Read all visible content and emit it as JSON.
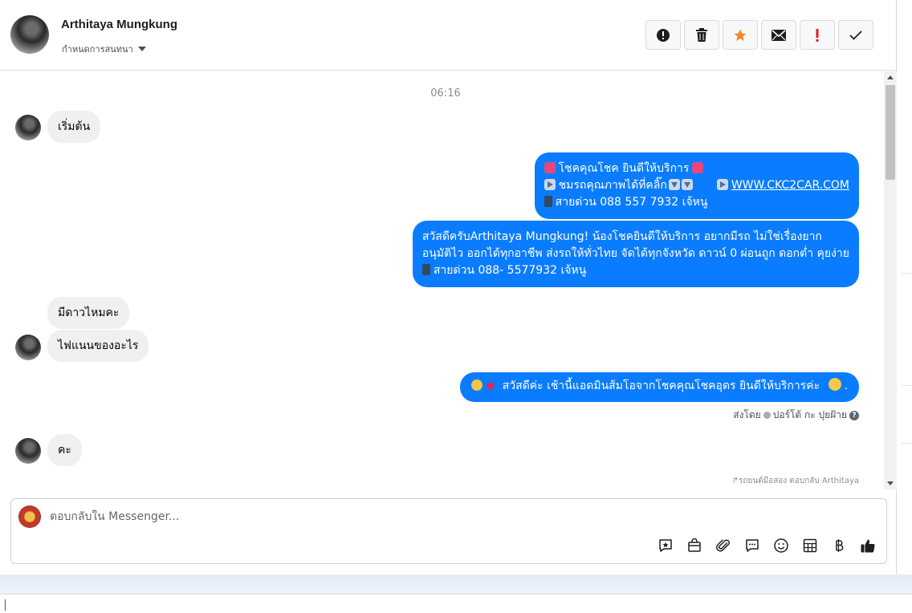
{
  "header": {
    "contact_name": "Arthitaya Mungkung",
    "assign_label": "กำหนดการสนทนา",
    "actions": [
      {
        "name": "mark-spam-button",
        "icon": "alert-circle-icon"
      },
      {
        "name": "delete-button",
        "icon": "trash-icon"
      },
      {
        "name": "star-button",
        "icon": "star-icon",
        "color": "#f5861f"
      },
      {
        "name": "mark-unread-button",
        "icon": "envelope-icon"
      },
      {
        "name": "follow-up-button",
        "icon": "exclamation-icon",
        "color": "#e02020"
      },
      {
        "name": "mark-done-button",
        "icon": "check-icon"
      }
    ]
  },
  "chat": {
    "timestamp": "06:16",
    "messages": [
      {
        "direction": "in",
        "text": "เริ่มต้น"
      },
      {
        "direction": "out",
        "lines": [
          "โชคคุณโชค ยินดีให้บริการ",
          "ชมรถคุณภาพได้ที่คลิ๊ก",
          "WWW.CKC2CAR.COM",
          "สายด่วน 088 557 7932 เจ้หนู"
        ]
      },
      {
        "direction": "out",
        "lines": [
          "สวัสดีครับArthitaya Mungkung! น้องโชคยินดีให้บริการ อยากมีรถ ไม่ใช่เรื่องยาก",
          "อนุมัติไว ออกได้ทุกอาชีพ ส่งรถให้ทั่วไทย จัดได้ทุกจังหวัด ดาวน์ 0  ผ่อนถูก ดอกต่ำ คุยง่าย",
          "สายด่วน 088- 5577932 เจ้หนู"
        ]
      },
      {
        "direction": "in",
        "text": "มีดาวไหมคะ"
      },
      {
        "direction": "in",
        "text": "ไฟแนนของอะไร"
      },
      {
        "direction": "out",
        "text": "สวัสดีค่ะ เช้านี้แอดมินส้มโอจากโชคคุณโชคอุดร ยินดีให้บริการค่ะ"
      },
      {
        "direction": "in",
        "text": "คะ"
      }
    ],
    "sent_by_label": "ส่งโดย",
    "sent_by_name": "ปอร์โต้ กะ ปุยฝ้าย",
    "reply_note": "รถยนต์มือสอง ตอบกลับ Arthitaya"
  },
  "composer": {
    "placeholder": "ตอบกลับใน Messenger...",
    "tools": [
      "saved-reply-icon",
      "shop-bag-icon",
      "paperclip-icon",
      "chat-bubble-icon",
      "smiley-icon",
      "grid-table-icon",
      "baht-icon",
      "thumbs-up-icon"
    ]
  },
  "colors": {
    "outgoing_bubble": "#0a7cff",
    "incoming_bubble": "#f0f0f0",
    "star": "#f5861f",
    "flag": "#e02020"
  }
}
